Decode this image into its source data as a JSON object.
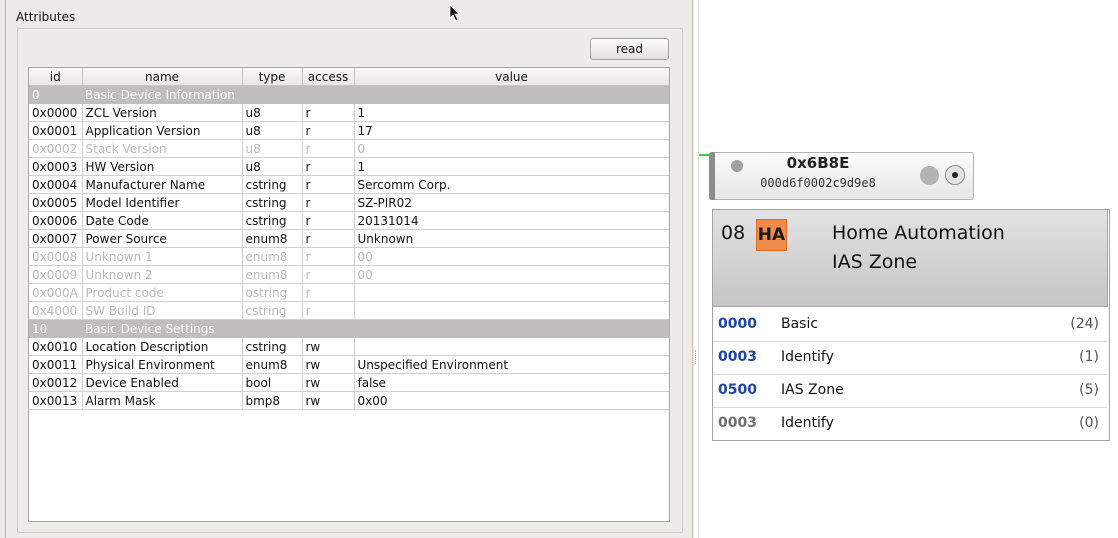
{
  "panel": {
    "title": "Attributes",
    "read_button": "read"
  },
  "table": {
    "columns": [
      "id",
      "name",
      "type",
      "access",
      "value"
    ],
    "rows": [
      {
        "kind": "group",
        "id": "0",
        "name": "Basic Device Information"
      },
      {
        "kind": "attr",
        "id": "0x0000",
        "name": "ZCL Version",
        "type": "u8",
        "access": "r",
        "value": "1"
      },
      {
        "kind": "attr",
        "id": "0x0001",
        "name": "Application Version",
        "type": "u8",
        "access": "r",
        "value": "17"
      },
      {
        "kind": "disabled",
        "id": "0x0002",
        "name": "Stack Version",
        "type": "u8",
        "access": "r",
        "value": "0"
      },
      {
        "kind": "attr",
        "id": "0x0003",
        "name": "HW Version",
        "type": "u8",
        "access": "r",
        "value": "1"
      },
      {
        "kind": "attr",
        "id": "0x0004",
        "name": "Manufacturer Name",
        "type": "cstring",
        "access": "r",
        "value": "Sercomm Corp."
      },
      {
        "kind": "attr",
        "id": "0x0005",
        "name": "Model Identifier",
        "type": "cstring",
        "access": "r",
        "value": "SZ-PIR02"
      },
      {
        "kind": "attr",
        "id": "0x0006",
        "name": "Date Code",
        "type": "cstring",
        "access": "r",
        "value": "20131014"
      },
      {
        "kind": "attr",
        "id": "0x0007",
        "name": "Power Source",
        "type": "enum8",
        "access": "r",
        "value": "Unknown"
      },
      {
        "kind": "disabled",
        "id": "0x0008",
        "name": "Unknown 1",
        "type": "enum8",
        "access": "r",
        "value": "00"
      },
      {
        "kind": "disabled",
        "id": "0x0009",
        "name": "Unknown 2",
        "type": "enum8",
        "access": "r",
        "value": "00"
      },
      {
        "kind": "disabled",
        "id": "0x000A",
        "name": "Product code",
        "type": "ostring",
        "access": "r",
        "value": ""
      },
      {
        "kind": "disabled",
        "id": "0x4000",
        "name": "SW Build ID",
        "type": "cstring",
        "access": "r",
        "value": ""
      },
      {
        "kind": "group",
        "id": "10",
        "name": "Basic Device Settings"
      },
      {
        "kind": "attr",
        "id": "0x0010",
        "name": "Location Description",
        "type": "cstring",
        "access": "rw",
        "value": ""
      },
      {
        "kind": "attr",
        "id": "0x0011",
        "name": "Physical Environment",
        "type": "enum8",
        "access": "rw",
        "value": "Unspecified Environment"
      },
      {
        "kind": "attr",
        "id": "0x0012",
        "name": "Device Enabled",
        "type": "bool",
        "access": "rw",
        "value": "false"
      },
      {
        "kind": "attr",
        "id": "0x0013",
        "name": "Alarm Mask",
        "type": "bmp8",
        "access": "rw",
        "value": "0x00"
      }
    ]
  },
  "node": {
    "short_address": "0x6B8E",
    "ext_address": "000d6f0002c9d9e8",
    "endpoint": "08",
    "profile_badge": "HA",
    "profile_name": "Home Automation",
    "device_name": "IAS Zone",
    "clusters": [
      {
        "id": "0000",
        "name": "Basic",
        "count": "(24)",
        "direction": "in"
      },
      {
        "id": "0003",
        "name": "Identify",
        "count": "(1)",
        "direction": "in"
      },
      {
        "id": "0500",
        "name": "IAS Zone",
        "count": "(5)",
        "direction": "in"
      },
      {
        "id": "0003",
        "name": "Identify",
        "count": "(0)",
        "direction": "out"
      }
    ]
  },
  "colors": {
    "in_cluster": "#1e46a0",
    "out_cluster": "#6e6e6e",
    "profile_badge": "#f08a4b",
    "group_row": "#c0bebc",
    "link": "#3ecf3e"
  }
}
